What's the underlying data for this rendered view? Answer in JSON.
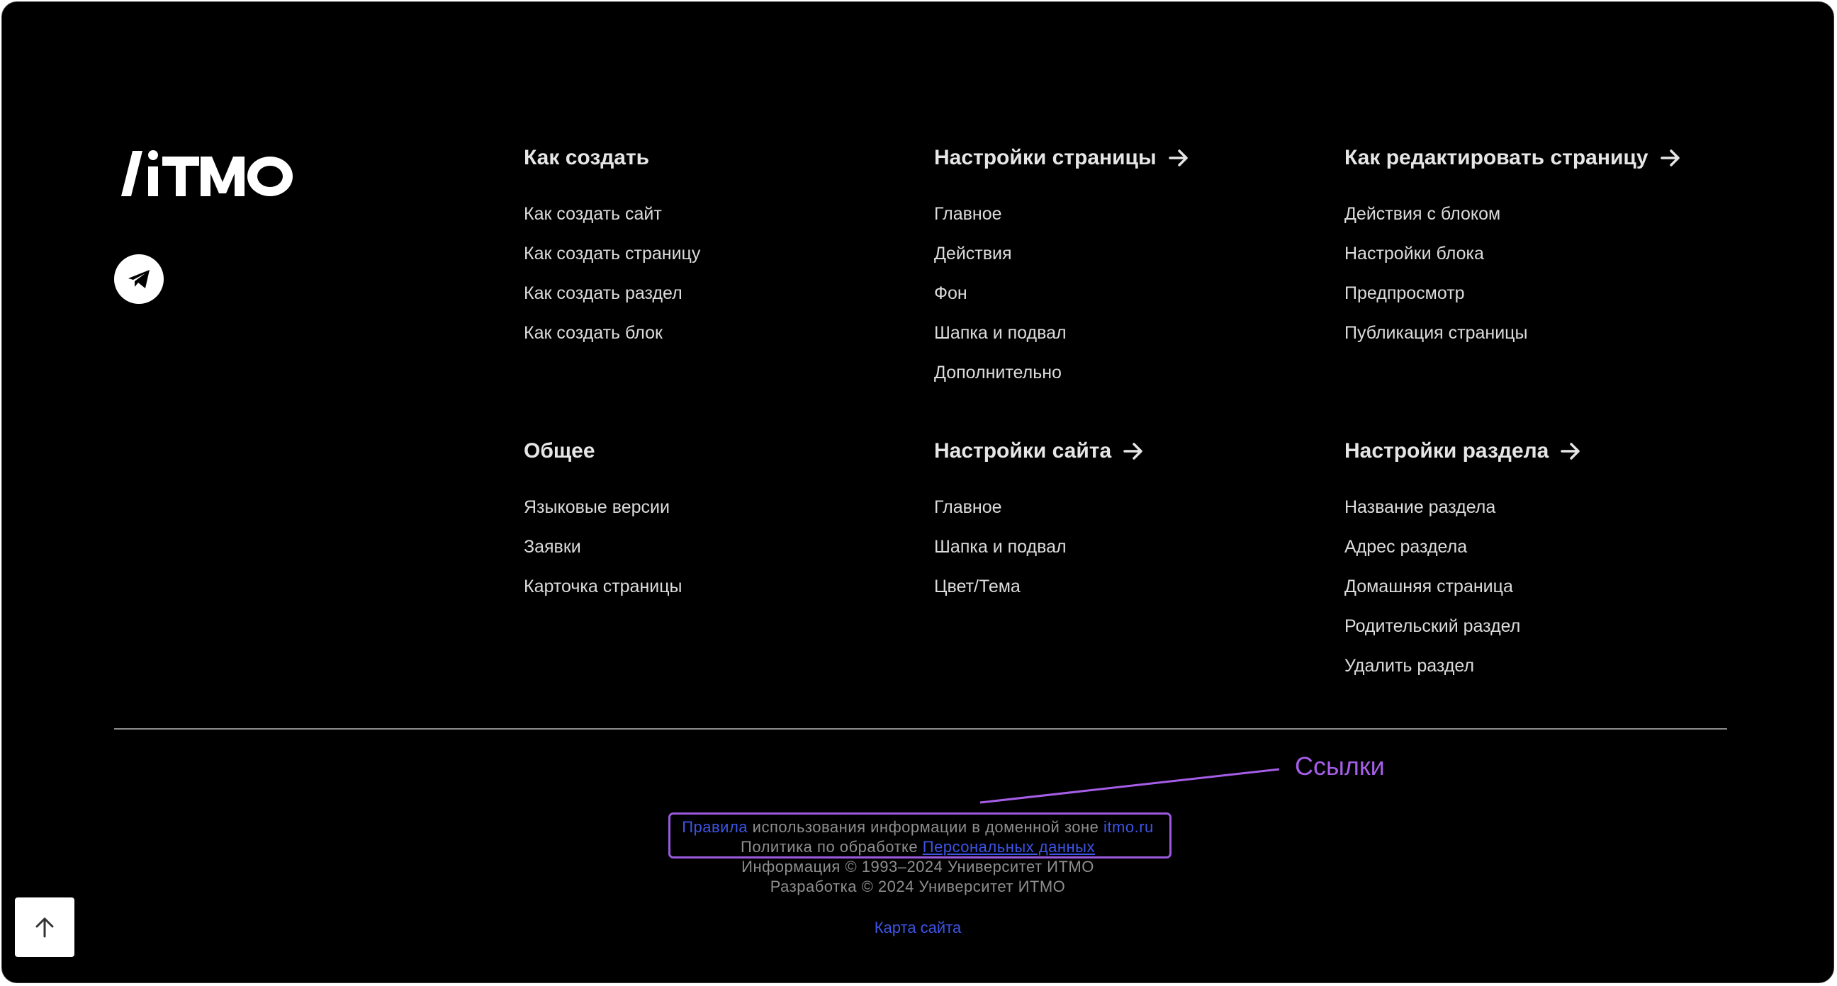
{
  "brand": {
    "logo_text": "ITMO"
  },
  "social": {
    "telegram_icon": "telegram-icon"
  },
  "columns": [
    {
      "title": "Как создать",
      "has_arrow": false,
      "items": [
        "Как создать сайт",
        "Как создать страницу",
        "Как создать раздел",
        "Как создать блок"
      ]
    },
    {
      "title": "Настройки страницы",
      "has_arrow": true,
      "items": [
        "Главное",
        "Действия",
        "Фон",
        "Шапка и подвал",
        "Дополнительно"
      ]
    },
    {
      "title": "Как редактировать страницу",
      "has_arrow": true,
      "items": [
        "Действия с блоком",
        "Настройки блока",
        "Предпросмотр",
        "Публикация страницы"
      ]
    },
    {
      "title": "Общее",
      "has_arrow": false,
      "items": [
        "Языковые версии",
        "Заявки",
        "Карточка страницы"
      ]
    },
    {
      "title": "Настройки сайта",
      "has_arrow": true,
      "items": [
        "Главное",
        "Шапка и подвал",
        "Цвет/Тема"
      ]
    },
    {
      "title": "Настройки раздела",
      "has_arrow": true,
      "items": [
        "Название раздела",
        "Адрес раздела",
        "Домашняя страница",
        "Родительский раздел",
        "Удалить раздел"
      ]
    }
  ],
  "footer": {
    "rules_link": "Правила",
    "rules_text": " использования информации в доменной зоне ",
    "domain_link": "itmo.ru",
    "policy_text": "Политика по обработке ",
    "personal_data_link": "Персональных данных",
    "copyright_info": "Информация © 1993–2024 Университет ИТМО",
    "copyright_dev": "Разработка © 2024 Университет ИТМО",
    "sitemap_link": "Карта сайта"
  },
  "annotation": {
    "label": "Ссылки",
    "color": "#a65ee8"
  },
  "colors": {
    "background": "#000000",
    "link": "#3d54e6",
    "heading": "#e6e6e6"
  },
  "scroll_up_icon": "arrow-up-icon"
}
